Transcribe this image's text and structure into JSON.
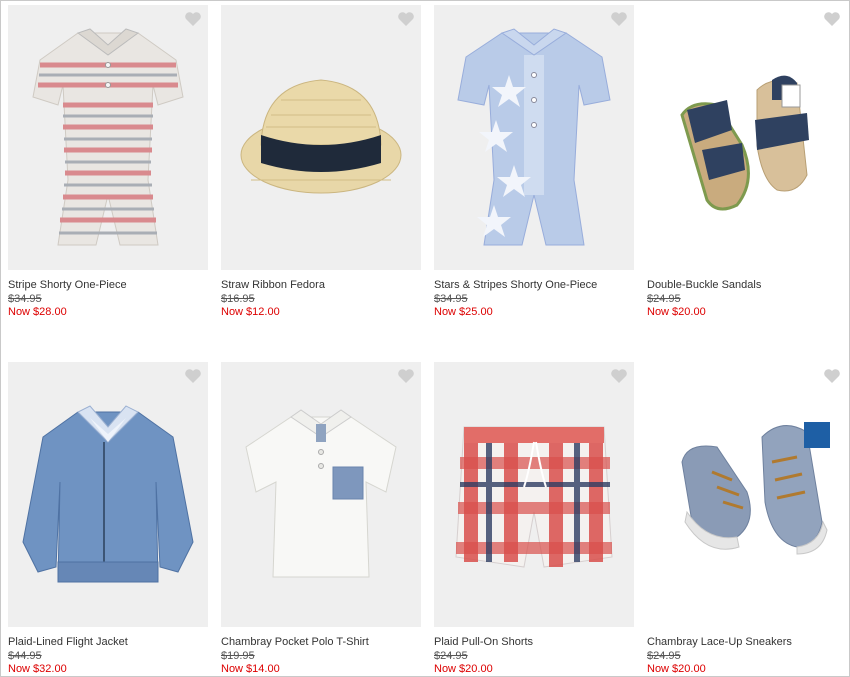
{
  "colors": {
    "sale": "#dd0000",
    "heart": "#cfcfcf",
    "tile": "#efefef"
  },
  "products": [
    {
      "name": "Stripe Shorty One-Piece",
      "was": "$34.95",
      "now": "Now $28.00",
      "icon": "heart-icon"
    },
    {
      "name": "Straw Ribbon Fedora",
      "was": "$16.95",
      "now": "Now $12.00",
      "icon": "heart-icon"
    },
    {
      "name": "Stars & Stripes Shorty One-Piece",
      "was": "$34.95",
      "now": "Now $25.00",
      "icon": "heart-icon"
    },
    {
      "name": "Double-Buckle Sandals",
      "was": "$24.95",
      "now": "Now $20.00",
      "icon": "heart-icon"
    },
    {
      "name": "Plaid-Lined Flight Jacket",
      "was": "$44.95",
      "now": "Now $32.00",
      "icon": "heart-icon"
    },
    {
      "name": "Chambray Pocket Polo T-Shirt",
      "was": "$19.95",
      "now": "Now $14.00",
      "icon": "heart-icon"
    },
    {
      "name": "Plaid Pull-On Shorts",
      "was": "$24.95",
      "now": "Now $20.00",
      "icon": "heart-icon"
    },
    {
      "name": "Chambray Lace-Up Sneakers",
      "was": "$24.95",
      "now": "Now $20.00",
      "icon": "heart-icon"
    }
  ]
}
